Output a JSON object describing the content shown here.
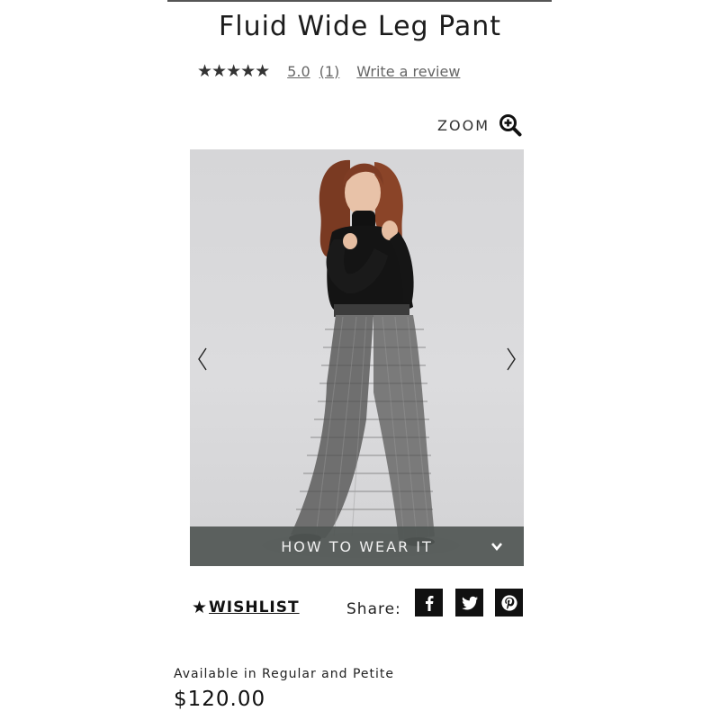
{
  "product": {
    "title": "Fluid Wide Leg Pant",
    "availability": "Available in Regular and Petite",
    "price": "$120.00"
  },
  "rating": {
    "stars": 5,
    "star_glyphs": "★★★★★",
    "score": "5.0",
    "count": "(1)",
    "write_review": "Write a review"
  },
  "gallery": {
    "zoom_label": "ZOOM",
    "zoom_icon": "zoom-in-icon",
    "prev_icon": "chevron-left-icon",
    "next_icon": "chevron-right-icon",
    "how_to_wear_label": "HOW TO WEAR IT",
    "how_to_wear_icon": "chevron-down-icon"
  },
  "actions": {
    "wishlist_star": "★",
    "wishlist_label": "WISHLIST",
    "share_label": "Share:",
    "social": [
      {
        "name": "facebook",
        "icon": "facebook-icon"
      },
      {
        "name": "twitter",
        "icon": "twitter-icon"
      },
      {
        "name": "pinterest",
        "icon": "pinterest-icon"
      }
    ]
  },
  "colors": {
    "text": "#1a1a1a",
    "link_gray": "#666666",
    "bar_bg": "#505654",
    "social_bg": "#111111",
    "photo_bg": "#d6d6d8"
  }
}
